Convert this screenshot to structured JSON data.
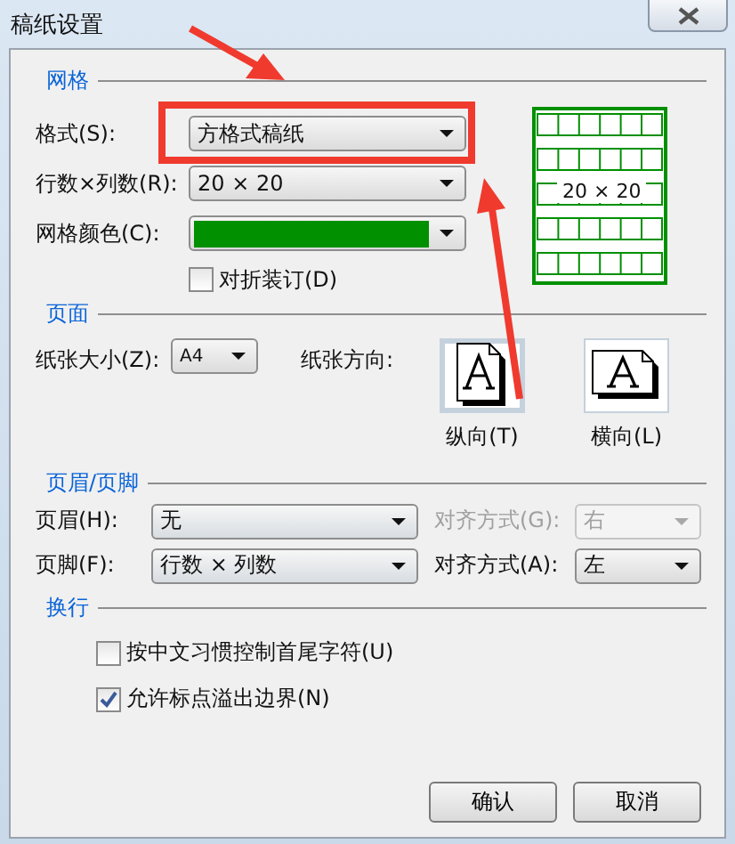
{
  "window": {
    "title": "稿纸设置"
  },
  "grid": {
    "heading": "网格",
    "format": {
      "label": "格式(S):",
      "value": "方格式稿纸"
    },
    "size": {
      "label": "行数×列数(R):",
      "value": "20 × 20"
    },
    "color": {
      "label": "网格颜色(C):",
      "color": "#009000"
    },
    "fold": {
      "label": "对折装订(D)",
      "checked": false
    },
    "preview": {
      "label": "20 × 20"
    }
  },
  "page": {
    "heading": "页面",
    "paper_size": {
      "label": "纸张大小(Z):",
      "value": "A4"
    },
    "orientation_label": "纸张方向:",
    "orientations": [
      {
        "label": "纵向(T)",
        "kind": "portrait",
        "selected": true
      },
      {
        "label": "横向(L)",
        "kind": "landscape",
        "selected": false
      }
    ]
  },
  "header_footer": {
    "heading": "页眉/页脚",
    "rows": [
      {
        "label": "页眉(H):",
        "value": "无",
        "align_label": "对齐方式(G):",
        "align_value": "右",
        "align_disabled": true
      },
      {
        "label": "页脚(F):",
        "value": "行数 × 列数",
        "align_label": "对齐方式(A):",
        "align_value": "左",
        "align_disabled": false
      }
    ]
  },
  "line_break": {
    "heading": "换行",
    "options": [
      {
        "label": "按中文习惯控制首尾字符(U)",
        "checked": false
      },
      {
        "label": "允许标点溢出边界(N)",
        "checked": true
      }
    ]
  },
  "buttons": [
    "确认",
    "取消"
  ]
}
